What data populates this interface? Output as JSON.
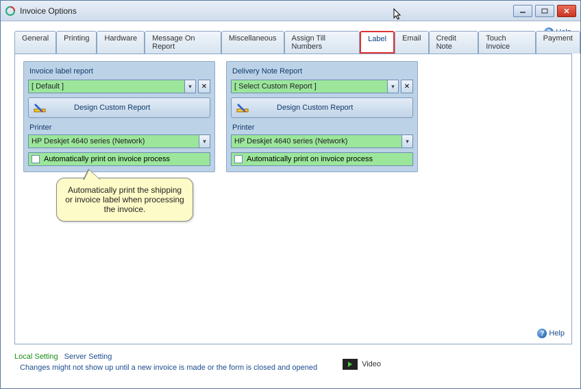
{
  "window": {
    "title": "Invoice Options"
  },
  "help_label": "Help",
  "tabs": [
    {
      "label": "General"
    },
    {
      "label": "Printing"
    },
    {
      "label": "Hardware"
    },
    {
      "label": "Message On Report"
    },
    {
      "label": "Miscellaneous"
    },
    {
      "label": "Assign Till Numbers"
    },
    {
      "label": "Label"
    },
    {
      "label": "Email"
    },
    {
      "label": "Credit Note"
    },
    {
      "label": "Touch Invoice"
    },
    {
      "label": "Payment"
    }
  ],
  "panelA": {
    "title": "Invoice label report",
    "report_select": "[ Default ]",
    "design_button": "Design Custom Report",
    "printer_label": "Printer",
    "printer_select": "HP Deskjet 4640 series (Network)",
    "auto_print_label": "Automatically print on invoice process"
  },
  "panelB": {
    "title": "Delivery Note Report",
    "report_select": "[ Select Custom Report ]",
    "design_button": "Design Custom Report",
    "printer_label": "Printer",
    "printer_select": "HP Deskjet 4640 series (Network)",
    "auto_print_label": "Automatically print on invoice process"
  },
  "callout_text": "Automatically print the shipping or invoice label when processing the invoice.",
  "footer": {
    "local": "Local Setting",
    "server": "Server Setting",
    "note": "Changes might not show up until a new invoice is made or the form is closed and opened",
    "video": "Video"
  }
}
